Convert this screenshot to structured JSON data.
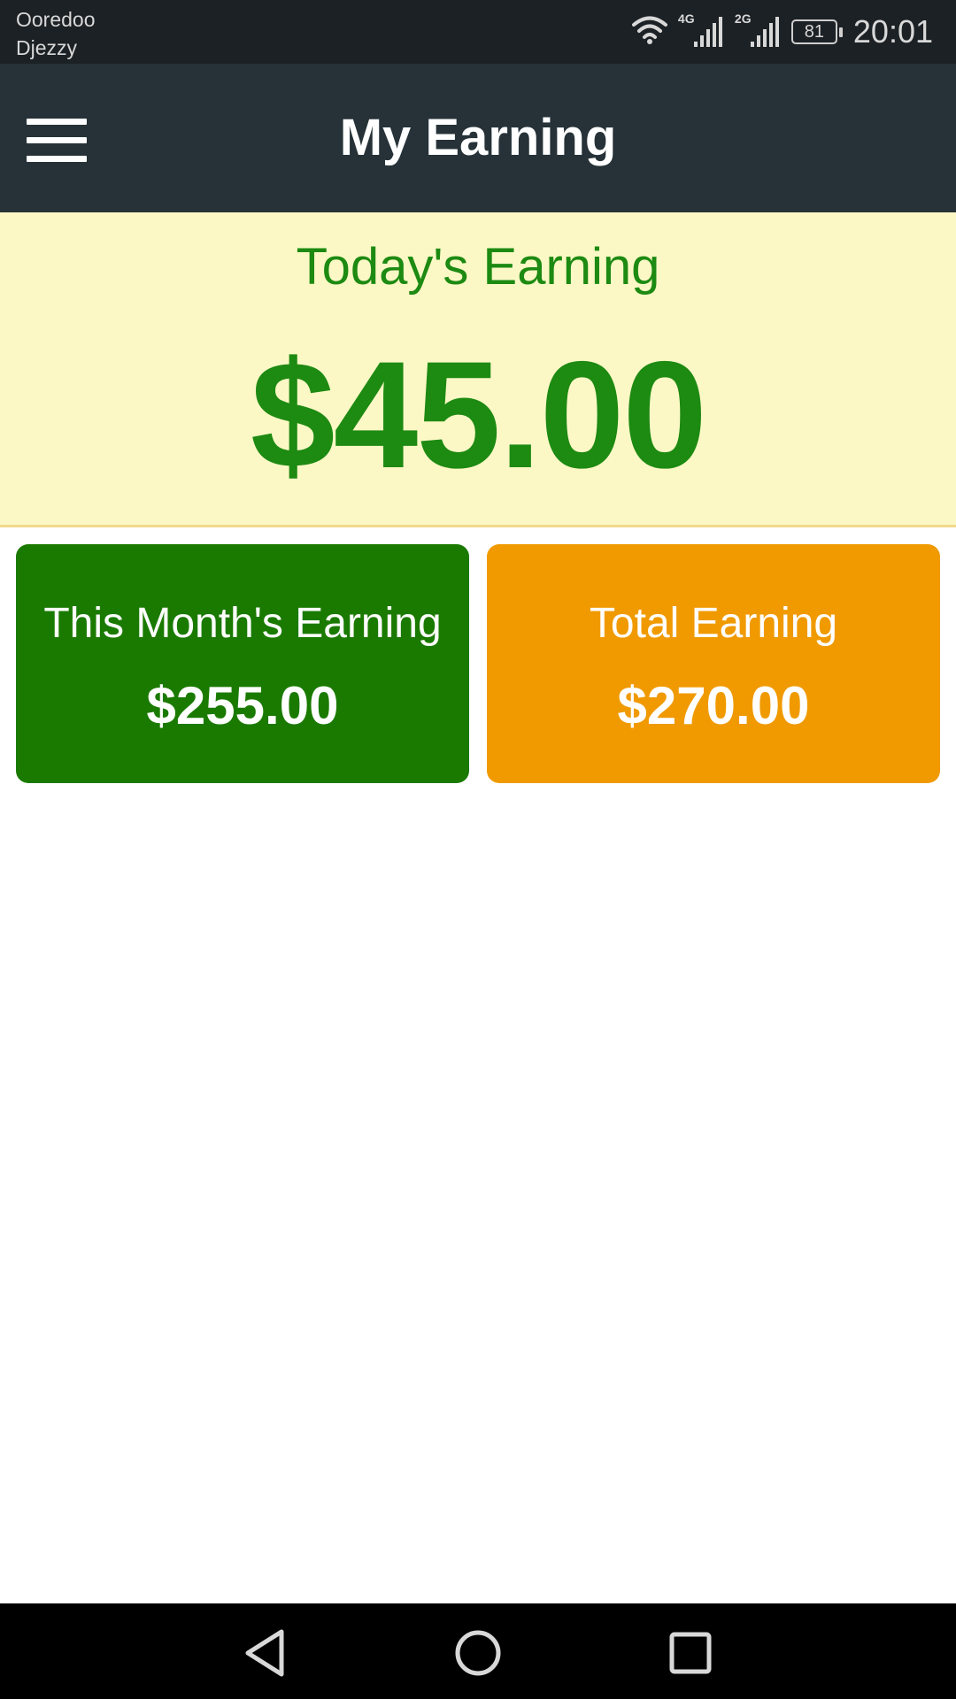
{
  "status_bar": {
    "carrier_1": "Ooredoo",
    "carrier_2": "Djezzy",
    "network_1": "4G",
    "network_2": "2G",
    "battery": "81",
    "time": "20:01",
    "icons": [
      "wifi-icon",
      "signal-icon",
      "signal-icon",
      "battery-icon"
    ]
  },
  "toolbar": {
    "title": "My Earning",
    "menu_icon": "hamburger-menu-icon"
  },
  "today": {
    "label": "Today's Earning",
    "value": "$45.00"
  },
  "cards": {
    "month": {
      "label": "This Month's Earning",
      "value": "$255.00"
    },
    "total": {
      "label": "Total Earning",
      "value": "$270.00"
    }
  },
  "nav_bar": {
    "icons": [
      "back-icon",
      "home-icon",
      "recent-apps-icon"
    ]
  },
  "colors": {
    "toolbar": "#263238",
    "today_bg": "#fcf8c6",
    "green": "#1d8a12",
    "month_card": "#1a7a00",
    "total_card": "#f09a00"
  }
}
